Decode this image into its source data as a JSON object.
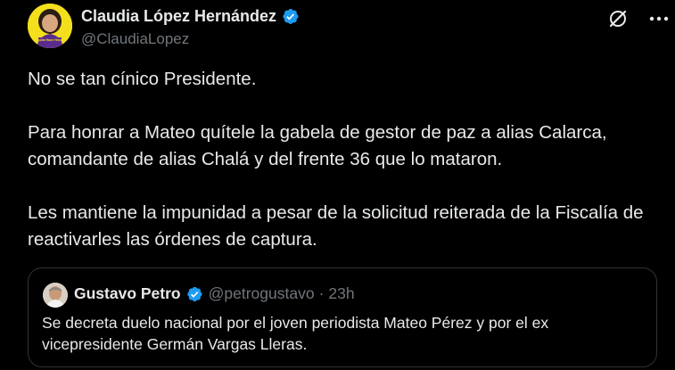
{
  "author": {
    "display_name": "Claudia López Hernández",
    "handle": "@ClaudiaLopez",
    "verified": true,
    "avatar_icon": "profile-photo-icon",
    "avatar_text": "Claudia Hace Historia"
  },
  "actions": {
    "grok_icon": "grok-icon",
    "more_icon": "more-icon"
  },
  "body": {
    "paragraphs": [
      "No se tan cínico Presidente.",
      "Para honrar a Mateo quítele la gabela de gestor de paz a alias Calarca, comandante de alias Chalá y del frente 36 que lo mataron.",
      "Les mantiene la impunidad a pesar de la solicitud reiterada de la Fiscalía de reactivarles las órdenes de captura."
    ]
  },
  "quoted": {
    "display_name": "Gustavo Petro",
    "handle": "@petrogustavo",
    "separator": "·",
    "time": "23h",
    "verified": true,
    "text": "Se decreta duelo nacional por el joven periodista Mateo Pérez y por el ex vicepresidente Germán Vargas Lleras."
  },
  "colors": {
    "background": "#000000",
    "text_primary": "#e7e9ea",
    "text_secondary": "#71767b",
    "verified_blue": "#1d9bf0",
    "border": "#2f3336",
    "avatar_yellow": "#f4df1d"
  }
}
